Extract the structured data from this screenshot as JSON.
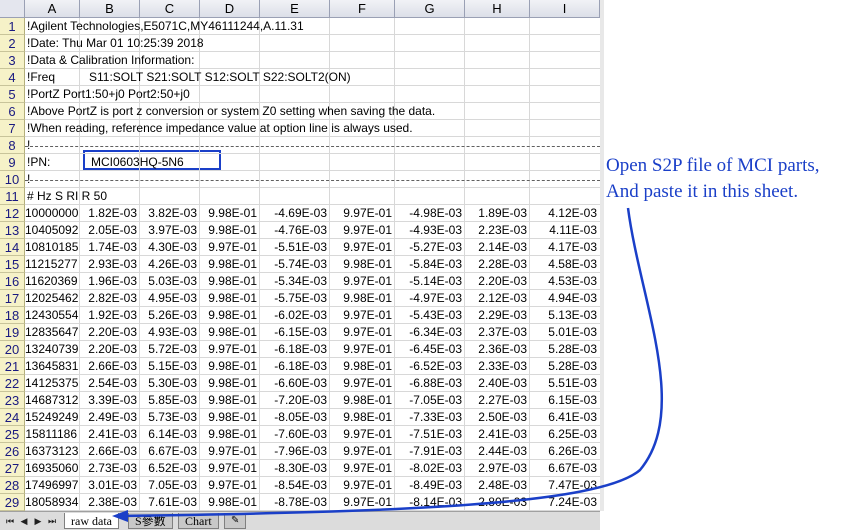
{
  "columns": [
    "A",
    "B",
    "C",
    "D",
    "E",
    "F",
    "G",
    "H",
    "I"
  ],
  "rows": [
    "1",
    "2",
    "3",
    "4",
    "5",
    "6",
    "7",
    "8",
    "9",
    "10",
    "11",
    "12",
    "13",
    "14",
    "15",
    "16",
    "17",
    "18",
    "19",
    "20",
    "21",
    "22",
    "23",
    "24",
    "25",
    "26",
    "27",
    "28",
    "29"
  ],
  "header_lines": [
    {
      "row": 1,
      "text": "!Agilent Technologies,E5071C,MY46111244,A.11.31"
    },
    {
      "row": 2,
      "text": "!Date: Thu Mar 01 10:25:39 2018"
    },
    {
      "row": 3,
      "text": "!Data & Calibration Information:"
    },
    {
      "row": 4,
      "text": "!Freq"
    },
    {
      "row": 4,
      "text": "S11:SOLT  S21:SOLT  S12:SOLT  S22:SOLT2(ON)"
    },
    {
      "row": 5,
      "text": "!PortZ  Port1:50+j0    Port2:50+j0"
    },
    {
      "row": 6,
      "text": "!Above PortZ is port z conversion or system Z0 setting when saving the data."
    },
    {
      "row": 7,
      "text": "!When reading, reference impedance value at option line is always used."
    },
    {
      "row": 8,
      "text": "!"
    },
    {
      "row": 9,
      "text": "!PN:"
    },
    {
      "row": 10,
      "text": "!"
    },
    {
      "row": 11,
      "text": "# Hz S RI R 50"
    }
  ],
  "pn_value": "MCI0603HQ-5N6",
  "data_rows": [
    [
      "10000000",
      "1.82E-03",
      "3.82E-03",
      "9.98E-01",
      "-4.69E-03",
      "9.97E-01",
      "-4.98E-03",
      "1.89E-03",
      "4.12E-03"
    ],
    [
      "10405092",
      "2.05E-03",
      "3.97E-03",
      "9.98E-01",
      "-4.76E-03",
      "9.97E-01",
      "-4.93E-03",
      "2.23E-03",
      "4.11E-03"
    ],
    [
      "10810185",
      "1.74E-03",
      "4.30E-03",
      "9.97E-01",
      "-5.51E-03",
      "9.97E-01",
      "-5.27E-03",
      "2.14E-03",
      "4.17E-03"
    ],
    [
      "11215277",
      "2.93E-03",
      "4.26E-03",
      "9.98E-01",
      "-5.74E-03",
      "9.98E-01",
      "-5.84E-03",
      "2.28E-03",
      "4.58E-03"
    ],
    [
      "11620369",
      "1.96E-03",
      "5.03E-03",
      "9.98E-01",
      "-5.34E-03",
      "9.97E-01",
      "-5.14E-03",
      "2.20E-03",
      "4.53E-03"
    ],
    [
      "12025462",
      "2.82E-03",
      "4.95E-03",
      "9.98E-01",
      "-5.75E-03",
      "9.98E-01",
      "-4.97E-03",
      "2.12E-03",
      "4.94E-03"
    ],
    [
      "12430554",
      "1.92E-03",
      "5.26E-03",
      "9.98E-01",
      "-6.02E-03",
      "9.97E-01",
      "-5.43E-03",
      "2.29E-03",
      "5.13E-03"
    ],
    [
      "12835647",
      "2.20E-03",
      "4.93E-03",
      "9.98E-01",
      "-6.15E-03",
      "9.97E-01",
      "-6.34E-03",
      "2.37E-03",
      "5.01E-03"
    ],
    [
      "13240739",
      "2.20E-03",
      "5.72E-03",
      "9.97E-01",
      "-6.18E-03",
      "9.97E-01",
      "-6.45E-03",
      "2.36E-03",
      "5.28E-03"
    ],
    [
      "13645831",
      "2.66E-03",
      "5.15E-03",
      "9.98E-01",
      "-6.18E-03",
      "9.98E-01",
      "-6.52E-03",
      "2.33E-03",
      "5.28E-03"
    ],
    [
      "14125375",
      "2.54E-03",
      "5.30E-03",
      "9.98E-01",
      "-6.60E-03",
      "9.97E-01",
      "-6.88E-03",
      "2.40E-03",
      "5.51E-03"
    ],
    [
      "14687312",
      "3.39E-03",
      "5.85E-03",
      "9.98E-01",
      "-7.20E-03",
      "9.98E-01",
      "-7.05E-03",
      "2.27E-03",
      "6.15E-03"
    ],
    [
      "15249249",
      "2.49E-03",
      "5.73E-03",
      "9.98E-01",
      "-8.05E-03",
      "9.98E-01",
      "-7.33E-03",
      "2.50E-03",
      "6.41E-03"
    ],
    [
      "15811186",
      "2.41E-03",
      "6.14E-03",
      "9.98E-01",
      "-7.60E-03",
      "9.97E-01",
      "-7.51E-03",
      "2.41E-03",
      "6.25E-03"
    ],
    [
      "16373123",
      "2.66E-03",
      "6.67E-03",
      "9.97E-01",
      "-7.96E-03",
      "9.97E-01",
      "-7.91E-03",
      "2.44E-03",
      "6.26E-03"
    ],
    [
      "16935060",
      "2.73E-03",
      "6.52E-03",
      "9.97E-01",
      "-8.30E-03",
      "9.97E-01",
      "-8.02E-03",
      "2.97E-03",
      "6.67E-03"
    ],
    [
      "17496997",
      "3.01E-03",
      "7.05E-03",
      "9.97E-01",
      "-8.54E-03",
      "9.97E-01",
      "-8.49E-03",
      "2.48E-03",
      "7.47E-03"
    ],
    [
      "18058934",
      "2.38E-03",
      "7.61E-03",
      "9.98E-01",
      "-8.78E-03",
      "9.97E-01",
      "-8.14E-03",
      "2.80E-03",
      "7.24E-03"
    ]
  ],
  "sheet_tabs": [
    "raw data",
    "S參數",
    "Chart"
  ],
  "annotation": [
    "Open S2P file of MCI parts,",
    "And paste it in this sheet."
  ],
  "nav_icons": [
    "first-sheet-icon",
    "prev-sheet-icon",
    "next-sheet-icon",
    "last-sheet-icon"
  ],
  "colors": {
    "annotation": "#1a3fc8",
    "highlight_box": "#1a3fc8",
    "row_header": "#f6f2c8"
  }
}
